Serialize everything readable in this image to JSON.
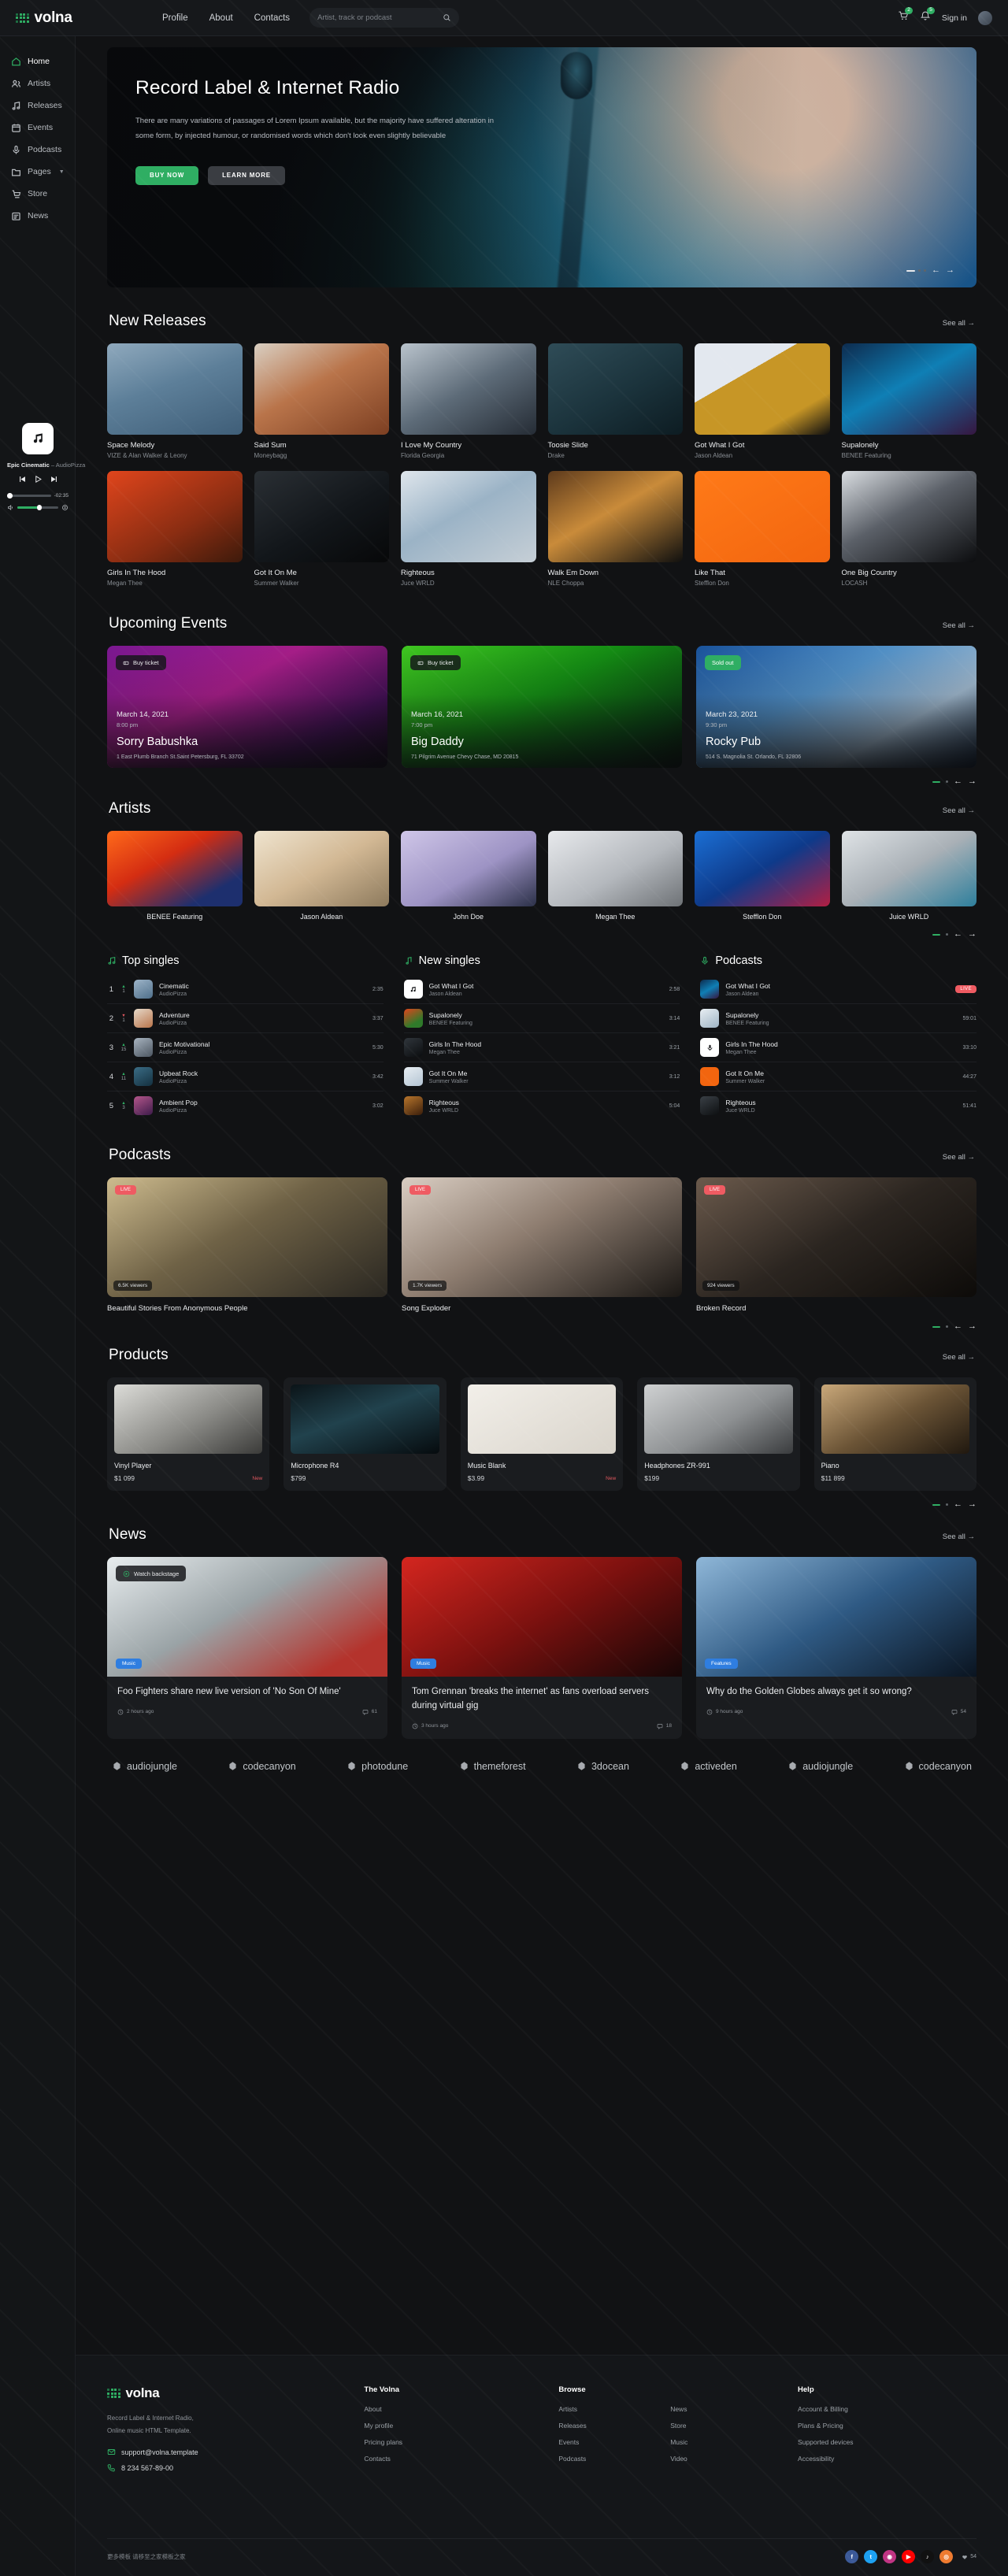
{
  "brand": {
    "name": "volna"
  },
  "topbar": {
    "nav": [
      {
        "label": "Profile"
      },
      {
        "label": "About"
      },
      {
        "label": "Contacts"
      }
    ],
    "search_placeholder": "Artist, track or podcast",
    "cart_count": "2",
    "notif_count": "5",
    "signin_label": "Sign in"
  },
  "sidebar": {
    "items": [
      {
        "label": "Home",
        "icon": "home-icon",
        "active": true
      },
      {
        "label": "Artists",
        "icon": "users-icon",
        "active": false
      },
      {
        "label": "Releases",
        "icon": "music-note-icon",
        "active": false
      },
      {
        "label": "Events",
        "icon": "calendar-icon",
        "active": false
      },
      {
        "label": "Podcasts",
        "icon": "microphone-icon",
        "active": false
      },
      {
        "label": "Pages",
        "icon": "folder-icon",
        "active": false,
        "chevron": true
      },
      {
        "label": "Store",
        "icon": "cart-icon",
        "active": false
      },
      {
        "label": "News",
        "icon": "news-icon",
        "active": false
      }
    ]
  },
  "player": {
    "track": "Epic Cinematic",
    "sep": " – ",
    "artist": "AudioPizza",
    "time": "-02:35"
  },
  "hero": {
    "title": "Record Label & Internet Radio",
    "paragraph": "There are many variations of passages of Lorem Ipsum available, but the majority have suffered alteration in some form, by injected humour, or randomised words which don't look even slightly believable",
    "buy_label": "BUY NOW",
    "learn_label": "LEARN MORE"
  },
  "new_releases": {
    "title": "New Releases",
    "see_all": "See all",
    "items": [
      {
        "name": "Space Melody",
        "artist": "VIZE & Alan Walker & Leony",
        "color": "linear-gradient(160deg,#8fa9bd,#5d7f99 45%,#3f5e78)"
      },
      {
        "name": "Said Sum",
        "artist": "Moneybagg",
        "color": "linear-gradient(150deg,#d9cfc2,#b9744a 45%,#7c3f22)"
      },
      {
        "name": "I Love My Country",
        "artist": "Florida Georgia",
        "color": "linear-gradient(150deg,#b9c3cc,#5d6b78 50%,#252c35)"
      },
      {
        "name": "Toosie Slide",
        "artist": "Drake",
        "color": "linear-gradient(150deg,#2f4c57,#1b333c 55%,#0d1c22)"
      },
      {
        "name": "Got What I Got",
        "artist": "Jason Aldean",
        "color": "linear-gradient(150deg,#e3e8ef 0 35%,#c79626 35% 75%,#0c0d10)"
      },
      {
        "name": "Supalonely",
        "artist": "BENEE Featuring",
        "color": "linear-gradient(150deg,#0d2b4e,#0f7fb5 45%,#361640)"
      },
      {
        "name": "Girls In The Hood",
        "artist": "Megan Thee",
        "color": "linear-gradient(150deg,#e0451c,#8a2d12 60%,#3d1a0b)"
      },
      {
        "name": "Got It On Me",
        "artist": "Summer Walker",
        "color": "linear-gradient(150deg,#2a2f34,#12161a 55%,#070809)"
      },
      {
        "name": "Righteous",
        "artist": "Juce WRLD",
        "color": "linear-gradient(150deg,#dfe6ec,#9bb3c6 45%,#c6cfd6)"
      },
      {
        "name": "Walk Em Down",
        "artist": "NLE Choppa",
        "color": "linear-gradient(150deg,#5d3a1c,#c98b3a 45%,#10100f)"
      },
      {
        "name": "Like That",
        "artist": "Stefflon Don",
        "color": "linear-gradient(150deg,#ff7a18,#f2650f)"
      },
      {
        "name": "One Big Country",
        "artist": "LOCASH",
        "color": "linear-gradient(150deg,#d9dde1,#5b6068 45%,#0c0d0f)"
      }
    ]
  },
  "events": {
    "title": "Upcoming Events",
    "see_all": "See all",
    "items": [
      {
        "tag": "Buy ticket",
        "sold": false,
        "date": "March 14, 2021",
        "time": "8:00 pm",
        "name": "Sorry Babushka",
        "address": "1 East Plumb Branch St.Saint Petersburg, FL 33702",
        "color": "linear-gradient(150deg,#8d1aa8,#c2219e 40%,#4b1060 75%,#130717)"
      },
      {
        "tag": "Buy ticket",
        "sold": false,
        "date": "March 16, 2021",
        "time": "7:00 pm",
        "name": "Big Daddy",
        "address": "71 Pilgrim Avenue Chevy Chase, MD 20815",
        "color": "linear-gradient(150deg,#49e824,#16a315 45%,#0a4c13 80%,#041006)"
      },
      {
        "tag": "Sold out",
        "sold": true,
        "date": "March 23, 2021",
        "time": "9:30 pm",
        "name": "Rocky Pub",
        "address": "514 S. Magnolia St. Orlando, FL 32806",
        "color": "linear-gradient(150deg,#1c5fb4,#5ea8e8 40%,#b9d6ef 70%,#0c1d34)"
      }
    ]
  },
  "artists": {
    "title": "Artists",
    "see_all": "See all",
    "items": [
      {
        "name": "BENEE Featuring",
        "color": "linear-gradient(150deg,#ff6a1a,#d42d12 40%,#1d2f6e 80%)"
      },
      {
        "name": "Jason Aldean",
        "color": "linear-gradient(150deg,#efe4cf,#d2b894 50%,#8d7a5d)"
      },
      {
        "name": "John Doe",
        "color": "linear-gradient(150deg,#cfc6e8,#9d93c4 55%,#2b3048)"
      },
      {
        "name": "Megan Thee",
        "color": "linear-gradient(150deg,#e7e9ec,#b4b8bd 55%,#6e7276)"
      },
      {
        "name": "Stefflon Don",
        "color": "linear-gradient(150deg,#1b6fd4,#0e3a8a 50%,#b11f43)"
      },
      {
        "name": "Juice WRLD",
        "color": "linear-gradient(150deg,#dfe3e6,#a9b0b6 50%,#2e7f9c)"
      }
    ]
  },
  "lists": {
    "top_singles": {
      "title": "Top singles",
      "icon": "music-note-icon",
      "rows": [
        {
          "rank": "1",
          "dir": "up",
          "delta": "1",
          "title": "Cinematic",
          "artist": "AudioPizza",
          "dur": "2:35",
          "color": "linear-gradient(150deg,#9db4c8,#4f6f8a)"
        },
        {
          "rank": "2",
          "dir": "down",
          "delta": "1",
          "title": "Adventure",
          "artist": "AudioPizza",
          "dur": "3:37",
          "color": "linear-gradient(150deg,#e6d9c9,#b9744a)"
        },
        {
          "rank": "3",
          "dir": "up",
          "delta": "15",
          "title": "Epic Motivational",
          "artist": "AudioPizza",
          "dur": "5:30",
          "color": "linear-gradient(150deg,#a8b4c0,#4b5560)"
        },
        {
          "rank": "4",
          "dir": "up",
          "delta": "11",
          "title": "Upbeat Rock",
          "artist": "AudioPizza",
          "dur": "3:42",
          "color": "linear-gradient(150deg,#3b6d86,#14303f)"
        },
        {
          "rank": "5",
          "dir": "up",
          "delta": "3",
          "title": "Ambient Pop",
          "artist": "AudioPizza",
          "dur": "3:02",
          "color": "linear-gradient(150deg,#b4568b,#3d1b4a)"
        }
      ]
    },
    "new_singles": {
      "title": "New singles",
      "icon": "music-note-single-icon",
      "rows": [
        {
          "title": "Got What I Got",
          "artist": "Jason Aldean",
          "dur": "2:58",
          "white": true
        },
        {
          "title": "Supalonely",
          "artist": "BENEE Featuring",
          "dur": "3:14",
          "color": "linear-gradient(150deg,#e0451c,#2f7a2a 70%)"
        },
        {
          "title": "Girls In The Hood",
          "artist": "Megan Thee",
          "dur": "3:21",
          "color": "linear-gradient(150deg,#30363c,#0b0d0f)"
        },
        {
          "title": "Got It On Me",
          "artist": "Summer Walker",
          "dur": "3:12",
          "color": "linear-gradient(150deg,#e8eef3,#b3c4d2)"
        },
        {
          "title": "Righteous",
          "artist": "Juce WRLD",
          "dur": "5:04",
          "color": "linear-gradient(150deg,#b9762c,#3a1e0b)"
        }
      ]
    },
    "podcasts": {
      "title": "Podcasts",
      "icon": "microphone-icon",
      "rows": [
        {
          "title": "Got What I Got",
          "artist": "Jason Aldean",
          "dur": "LIVE",
          "live": true,
          "color": "linear-gradient(150deg,#0d2b4e,#0f7fb5 50%,#361640)"
        },
        {
          "title": "Supalonely",
          "artist": "BENEE Featuring",
          "dur": "59:01",
          "color": "linear-gradient(150deg,#e8eef3,#9fb4c4)"
        },
        {
          "title": "Girls In The Hood",
          "artist": "Megan Thee",
          "dur": "33:10",
          "white": true,
          "icon": "microphone-icon"
        },
        {
          "title": "Got It On Me",
          "artist": "Summer Walker",
          "dur": "44:27",
          "orange": true
        },
        {
          "title": "Righteous",
          "artist": "Juce WRLD",
          "dur": "51:41",
          "color": "linear-gradient(150deg,#3a4046,#0d0f11)"
        }
      ]
    }
  },
  "podcasts_section": {
    "title": "Podcasts",
    "see_all": "See all",
    "items": [
      {
        "live": "LIVE",
        "viewers": "6.5K viewers",
        "name": "Beautiful Stories From Anonymous People",
        "color": "linear-gradient(150deg,#cdbb8e,#6f6246 45%,#2a2721)"
      },
      {
        "live": "LIVE",
        "viewers": "1.7K viewers",
        "name": "Song Exploder",
        "color": "linear-gradient(150deg,#d9cdc2,#8e7d70 45%,#1a1714)"
      },
      {
        "live": "LIVE",
        "viewers": "924 viewers",
        "name": "Broken Record",
        "color": "linear-gradient(150deg,#6b5a4c,#2b2520 50%,#0d0b09)"
      }
    ]
  },
  "products": {
    "title": "Products",
    "see_all": "See all",
    "items": [
      {
        "name": "Vinyl Player",
        "price": "$1 099",
        "badge": "New",
        "color": "linear-gradient(150deg,#dcdcd8,#8a8a86 55%,#3b3b39)"
      },
      {
        "name": "Microphone R4",
        "price": "$799",
        "badge": "",
        "color": "linear-gradient(160deg,#0b1418,#21424d 45%,#060b0e)"
      },
      {
        "name": "Music Blank",
        "price": "$3.99",
        "badge": "New",
        "color": "linear-gradient(150deg,#f2efe9,#d9d4cb)"
      },
      {
        "name": "Headphones ZR-991",
        "price": "$199",
        "badge": "",
        "color": "linear-gradient(150deg,#cfd1d2,#8d9092 55%,#3a3c3e)"
      },
      {
        "name": "Piano",
        "price": "$11 899",
        "badge": "",
        "color": "linear-gradient(150deg,#c9a87a,#6b5436 50%,#20180f)"
      }
    ]
  },
  "news": {
    "title": "News",
    "see_all": "See all",
    "items": [
      {
        "watch": "Watch backstage",
        "cat": "Music",
        "title": "Foo Fighters share new live version of 'No Son Of Mine'",
        "time": "2 hours ago",
        "comments": "61",
        "color": "linear-gradient(150deg,#e8edef,#9aa3a6 45%,#b4332c 85%)"
      },
      {
        "watch": "",
        "cat": "Music",
        "title": "Tom Grennan 'breaks the internet' as fans overload servers during virtual gig",
        "time": "3 hours ago",
        "comments": "18",
        "color": "linear-gradient(150deg,#d4261f,#7c110f 50%,#160606)"
      },
      {
        "watch": "",
        "cat": "Features",
        "title": "Why do the Golden Globes always get it so wrong?",
        "time": "9 hours ago",
        "comments": "54",
        "color": "linear-gradient(150deg,#8fb7d8,#2f5a84 50%,#0a1420)"
      }
    ]
  },
  "logos": [
    {
      "label": "audiojungle"
    },
    {
      "label": "codecanyon"
    },
    {
      "label": "photodune"
    },
    {
      "label": "themeforest"
    },
    {
      "label": "3docean"
    },
    {
      "label": "activeden"
    },
    {
      "label": "audiojungle"
    },
    {
      "label": "codecanyon"
    }
  ],
  "footer": {
    "desc_line1": "Record Label & Internet Radio,",
    "desc_line2": "Online music HTML Template.",
    "email": "support@volna.template",
    "phone": "8 234 567-89-00",
    "cols": [
      {
        "head": "The Volna",
        "links": [
          "About",
          "My profile",
          "Pricing plans",
          "Contacts"
        ]
      },
      {
        "head": "Browse",
        "links": [
          "Artists",
          "Releases",
          "Events",
          "Podcasts"
        ],
        "links2": [
          "News",
          "Store",
          "Music",
          "Video"
        ]
      },
      {
        "head": "Help",
        "links": [
          "Account & Billing",
          "Plans & Pricing",
          "Supported devices",
          "Accessibility"
        ]
      }
    ],
    "copyright": "更多模板 请移至之家模板之家",
    "follow_count": "54",
    "socials": [
      {
        "name": "facebook-icon",
        "glyph": "f",
        "color": "#3b5998"
      },
      {
        "name": "twitter-icon",
        "glyph": "t",
        "color": "#1da1f2"
      },
      {
        "name": "instagram-icon",
        "glyph": "◉",
        "color": "#c13584"
      },
      {
        "name": "youtube-icon",
        "glyph": "▶",
        "color": "#ff0000"
      },
      {
        "name": "tiktok-icon",
        "glyph": "♪",
        "color": "#111111"
      },
      {
        "name": "rss-icon",
        "glyph": "◎",
        "color": "#ee7b30"
      }
    ]
  }
}
